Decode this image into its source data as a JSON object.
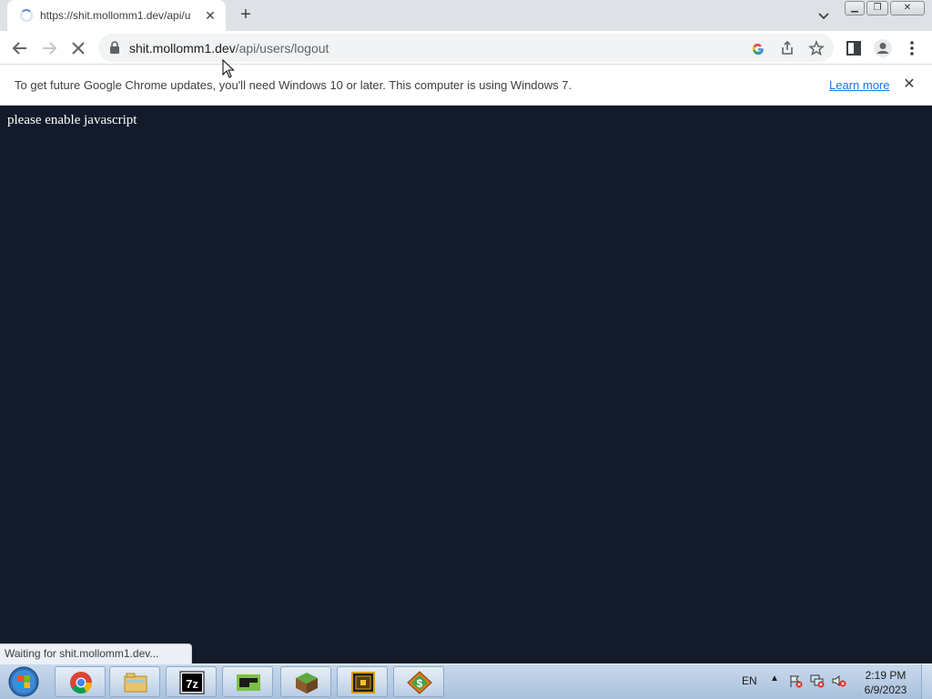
{
  "browser": {
    "tab": {
      "title": "https://shit.mollomm1.dev/api/u"
    },
    "new_tab_symbol": "+",
    "address": {
      "host": "shit.mollomm1.dev",
      "path": "/api/users/logout"
    },
    "infobar": {
      "message": "To get future Google Chrome updates, you'll need Windows 10 or later. This computer is using Windows 7.",
      "link": "Learn more"
    },
    "status": "Waiting for shit.mollomm1.dev..."
  },
  "page": {
    "text": "please enable javascript"
  },
  "taskbar": {
    "apps": [
      "chrome-icon",
      "file-explorer-icon",
      "7zip-icon",
      "terminal-icon",
      "minecraft-icon",
      "treasure-chest-icon",
      "money-icon"
    ],
    "lang": "EN",
    "time": "2:19 PM",
    "date": "6/9/2023"
  },
  "colors": {
    "page_bg": "#131a29",
    "link": "#1a73e8",
    "tab_strip": "#dee1e6"
  }
}
